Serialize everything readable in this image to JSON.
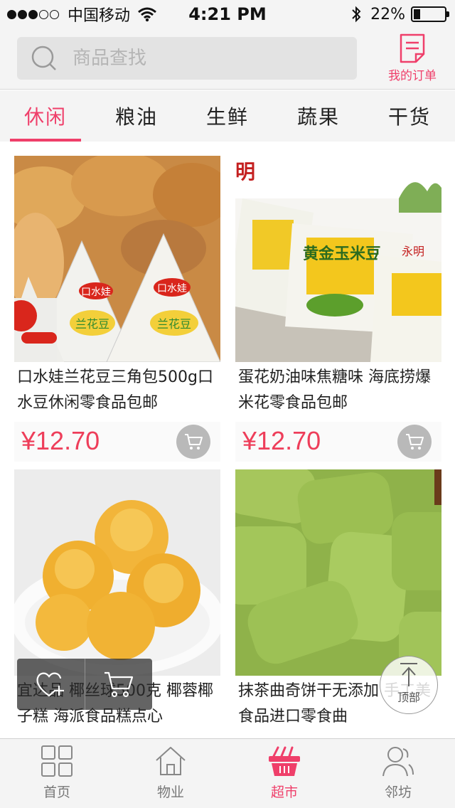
{
  "status_bar": {
    "carrier": "中国移动",
    "time": "4:21 PM",
    "battery_percent": "22%",
    "battery_level": 0.22,
    "signal_bars_filled": 3,
    "signal_bars_total": 5
  },
  "header": {
    "search_placeholder": "商品查找",
    "orders_label": "我的订单",
    "accent_color": "#ef3f6a"
  },
  "tabs": [
    {
      "label": "休闲",
      "active": true
    },
    {
      "label": "粮油",
      "active": false
    },
    {
      "label": "生鲜",
      "active": false
    },
    {
      "label": "蔬果",
      "active": false
    },
    {
      "label": "干货",
      "active": false
    }
  ],
  "products": [
    {
      "title": "口水娃兰花豆三角包500g口水豆休闲零食品包邮",
      "price": "¥12.70",
      "image_logo": "口水娃",
      "image_text": "兰花豆"
    },
    {
      "title": "蛋花奶油味焦糖味 海底捞爆米花零食品包邮",
      "price": "¥12.70",
      "image_logo": "永明",
      "image_text": "黄金玉米豆"
    },
    {
      "title": "宜达品 椰丝球500克 椰蓉椰子糕 海派食品糕点心",
      "price": ""
    },
    {
      "title": "抹茶曲奇饼干无添加 手工美食品进口零食曲",
      "price": ""
    }
  ],
  "overlay": {
    "favorite_icon": "heart-plus-icon",
    "cart_icon": "cart-icon"
  },
  "top_button": {
    "label": "顶部"
  },
  "bottom_nav": [
    {
      "label": "首页",
      "icon": "grid-icon",
      "active": false
    },
    {
      "label": "物业",
      "icon": "house-icon",
      "active": false
    },
    {
      "label": "超市",
      "icon": "basket-icon",
      "active": true
    },
    {
      "label": "邻坊",
      "icon": "people-icon",
      "active": false
    }
  ],
  "colors": {
    "accent": "#ef3f6a",
    "price": "#ee3e5a",
    "nav_inactive": "#777777"
  }
}
